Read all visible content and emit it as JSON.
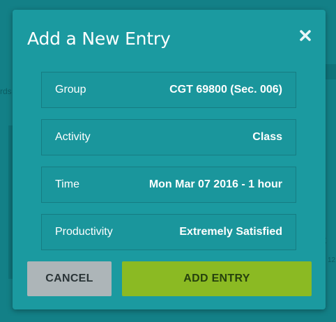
{
  "background": {
    "left_fragment": "rds",
    "right_fragment_1": "t",
    "right_fragment_2": "12"
  },
  "modal": {
    "title": "Add a New Entry",
    "close_icon": "close-icon",
    "rows": [
      {
        "label": "Group",
        "value": "CGT 69800 (Sec. 006)"
      },
      {
        "label": "Activity",
        "value": "Class"
      },
      {
        "label": "Time",
        "value": "Mon Mar 07 2016 - 1 hour"
      },
      {
        "label": "Productivity",
        "value": "Extremely Satisfied"
      }
    ],
    "cancel_label": "CANCEL",
    "add_label": "ADD ENTRY"
  },
  "colors": {
    "modal_bg": "#1b9aa0",
    "row_border": "#167c82",
    "cancel_bg": "#adb5b8",
    "add_bg": "#8bba23",
    "text": "#ffffff"
  }
}
